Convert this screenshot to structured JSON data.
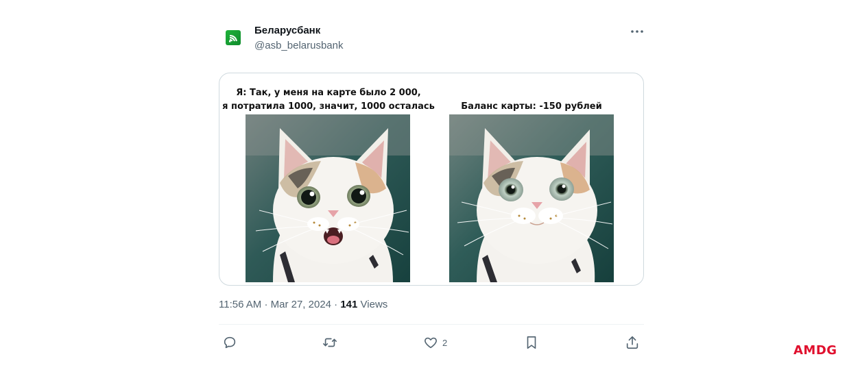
{
  "author": {
    "display_name": "Беларусбанк",
    "handle": "@asb_belarusbank",
    "avatar_icon": "belarusbank-logo-icon",
    "brand_color": "#1fb33a"
  },
  "more_icon": "more-horizontal-icon",
  "media": {
    "left_caption_bold": "Я:",
    "left_caption_line1_rest": "Так, у меня на карте было 2 000,",
    "left_caption_line2": "я потратила 1000, значит, 1000 осталась",
    "right_caption": "Баланс карты:  -150 рублей",
    "left_photo": "surprised-cat-mouth-open",
    "right_photo": "surprised-cat-wide-eyes"
  },
  "meta": {
    "time": "11:56 AM",
    "separator": "·",
    "date": "Mar 27, 2024",
    "views_count": "141",
    "views_label": "Views"
  },
  "actions": {
    "reply_icon": "reply-icon",
    "retweet_icon": "retweet-icon",
    "like_icon": "heart-icon",
    "like_count": "2",
    "bookmark_icon": "bookmark-icon",
    "share_icon": "share-icon"
  },
  "watermark": "AMDG",
  "colors": {
    "text_primary": "#0f1419",
    "text_secondary": "#536471",
    "border": "#cfd9de",
    "watermark": "#e0102e"
  }
}
